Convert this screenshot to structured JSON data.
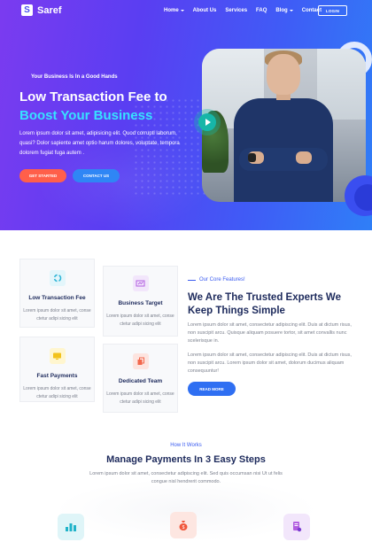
{
  "brand": {
    "logo_letter": "S",
    "name": "Saref"
  },
  "nav": {
    "items": [
      {
        "label": "Home",
        "has_caret": true
      },
      {
        "label": "About Us",
        "has_caret": false
      },
      {
        "label": "Services",
        "has_caret": false
      },
      {
        "label": "FAQ",
        "has_caret": false
      },
      {
        "label": "Blog",
        "has_caret": true
      },
      {
        "label": "Contact",
        "has_caret": false
      }
    ],
    "login_label": "LOGIN"
  },
  "hero": {
    "eyebrow": "Your Business Is In a Good Hands",
    "title_line1": "Low Transaction Fee to",
    "title_line2": "Boost Your Business",
    "description": "Lorem ipsum dolor sit amet, adipisicing elit. Quod corrupti laborum, quasi? Dolor sapiente amet optio harum dolores, voluptate, tempora dolorem fugiat fuga autem .",
    "btn_started": "GET STARTED",
    "btn_contact": "CONTACT US",
    "accent_color": "#37e2ff"
  },
  "features": {
    "cards": [
      {
        "title": "Low Transaction Fee",
        "text": "Lorem ipsum dolor sit amet, conse ctetur adipi sicing elit",
        "icon": "spinner-icon"
      },
      {
        "title": "Business Target",
        "text": "Lorem ipsum dolor sit amet, conse ctetur adipi sicing elit",
        "icon": "target-icon"
      },
      {
        "title": "Fast Payments",
        "text": "Lorem ipsum dolor sit amet, conse ctetur adipi sicing elit",
        "icon": "monitor-icon"
      },
      {
        "title": "Dedicated Team",
        "text": "Lorem ipsum dolor sit amet, conse ctetur adipi sicing elit",
        "icon": "copy-icon"
      }
    ],
    "core_label": "Our Core Features!",
    "core_title": "We Are The Trusted Experts We Keep Things Simple",
    "core_p1": "Lorem ipsum dolor sit amet, consectetur adipiscing elit. Duis at dictum risus, non suscipit arcu. Quisque aliquam posuere tortor, sit amet convallis nunc scelerisque in.",
    "core_p2": "Lorem ipsum dolor sit amet, consectetur adipiscing elit. Duis at dictum risus, non suscipit arcu. Lorem ipsum dolor sit amet, dolorum ducimus aliquam consequuntur!",
    "read_more": "READ MORE"
  },
  "how": {
    "label": "How It Works",
    "title": "Manage Payments In 3 Easy Steps",
    "text": "Lorem ipsum dolor sit amet, consectetur adipiscing elit. Sed quis occumsan nisi Ut ut felis congue nisl hendrerit commodo.",
    "steps": [
      {
        "icon": "bar-chart-icon"
      },
      {
        "icon": "money-bag-icon"
      },
      {
        "icon": "document-icon"
      }
    ]
  }
}
